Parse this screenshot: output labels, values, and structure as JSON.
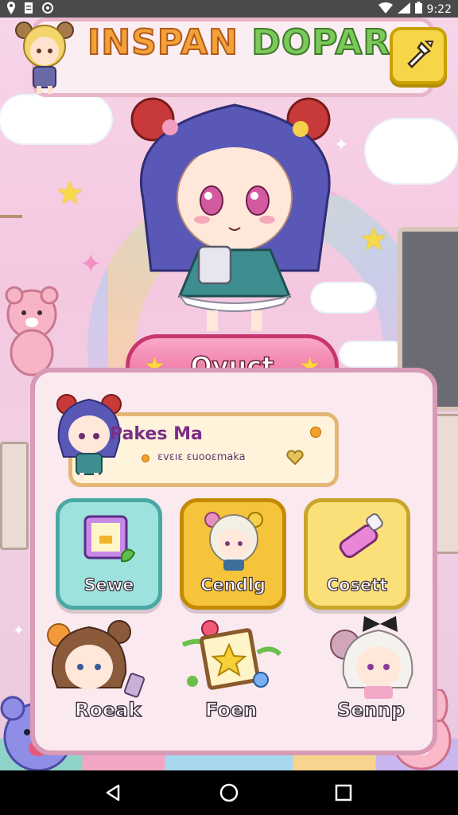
{
  "status_bar": {
    "time": "9:22"
  },
  "header": {
    "title_part_1": "INSPAN",
    "title_part_2": "DOPAR",
    "settings_icon": "wrench-icon"
  },
  "character": {
    "name": "Oyuct"
  },
  "profile_card": {
    "title": "Pakes Ma",
    "subtitle": "ɛvɛıɛ ɛuooɛmaka"
  },
  "menu_tiles": [
    {
      "label": "Sewe",
      "icon": "picture-frame-icon",
      "color": "#9ee2de"
    },
    {
      "label": "Cendlg",
      "icon": "chibi-friend-icon",
      "color": "#f6c43a"
    },
    {
      "label": "Cosett",
      "icon": "lipstick-icon",
      "color": "#fbe07a"
    }
  ],
  "bottom_items": [
    {
      "label": "Roeak",
      "icon": "chibi-girl-icon"
    },
    {
      "label": "Foen",
      "icon": "easel-star-icon"
    },
    {
      "label": "Sennp",
      "icon": "chibi-bow-icon"
    }
  ],
  "colors": {
    "accent_pink": "#e8588f",
    "panel_border": "#d89ab6",
    "title_orange": "#f3a23a"
  }
}
